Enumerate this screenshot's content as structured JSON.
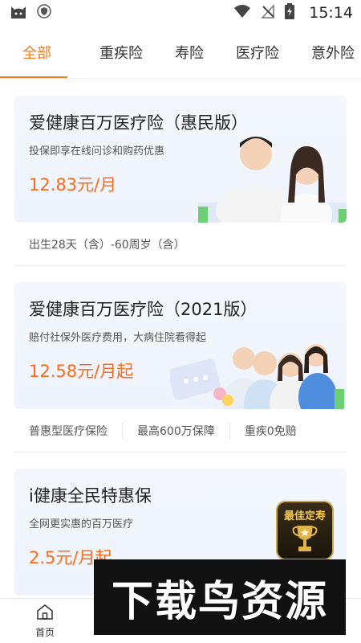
{
  "status_bar": {
    "time": "15:14",
    "icons": [
      "cat-app-icon",
      "shield-app-icon",
      "wifi-icon",
      "no-signal-icon",
      "battery-charging-icon"
    ]
  },
  "tabs": [
    {
      "label": "全部",
      "active": true
    },
    {
      "label": "重疾险",
      "active": false
    },
    {
      "label": "寿险",
      "active": false
    },
    {
      "label": "医疗险",
      "active": false
    },
    {
      "label": "意外险",
      "active": false
    }
  ],
  "products": [
    {
      "title": "爱健康百万医疗险（惠民版）",
      "subtitle": "投保即享在线问诊和购药优惠",
      "price": "12.83元/月",
      "tags": [
        "出生28天（含）-60周岁（含）"
      ]
    },
    {
      "title": "爱健康百万医疗险（2021版）",
      "subtitle": "赔付社保外医疗费用，大病住院看得起",
      "price": "12.58元/月起",
      "tags": [
        "普惠型医疗保险",
        "最高600万保障",
        "重疾0免赔"
      ]
    },
    {
      "title": "i健康全民特惠保",
      "subtitle": "全网更实惠的百万医疗",
      "price": "2.5元/月起",
      "badge": "最佳定寿",
      "tags": []
    }
  ],
  "bottom_nav": {
    "home_label": "首页"
  },
  "watermark": "下载鸟资源",
  "colors": {
    "accent": "#ff7a1a",
    "price": "#ff6a1a",
    "banner_bg": "#f0f4fc"
  }
}
